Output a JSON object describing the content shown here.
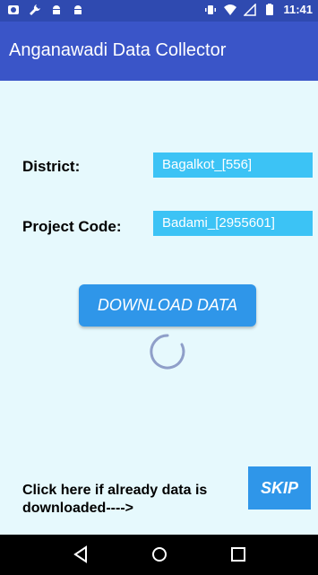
{
  "status_bar": {
    "time": "11:41",
    "icons": [
      "app-icon",
      "wrench-icon",
      "android-icon",
      "android-icon",
      "vibrate-icon",
      "wifi-icon",
      "no-sim-icon",
      "battery-icon"
    ]
  },
  "app_bar": {
    "title": "Anganawadi Data Collector"
  },
  "form": {
    "district_label": "District:",
    "district_value": "Bagalkot_[556]",
    "project_label": "Project Code:",
    "project_value": "Badami_[2955601]"
  },
  "download_button": {
    "label": "DOWNLOAD DATA"
  },
  "skip_section": {
    "text": "Click here if already data is downloaded---->",
    "button_label": "SKIP"
  },
  "nav_bar": {
    "buttons": [
      "back-icon",
      "home-icon",
      "recents-icon"
    ]
  },
  "colors": {
    "status_bar": "#2f4ab0",
    "app_bar": "#3a55c8",
    "background": "#e6f9fd",
    "field": "#3cc3f5",
    "button": "#2f96e9"
  }
}
